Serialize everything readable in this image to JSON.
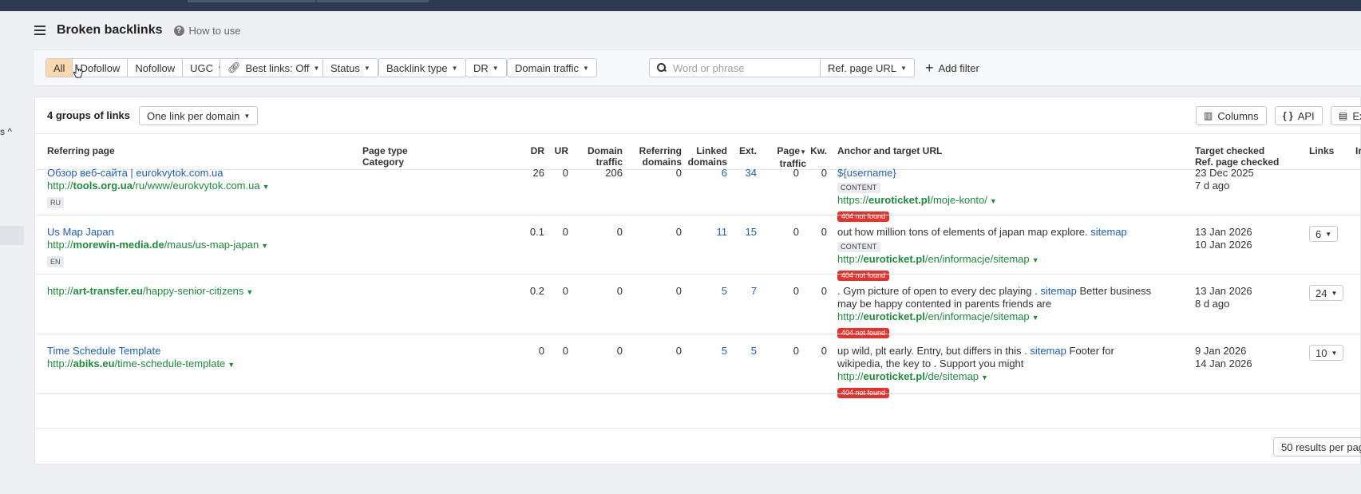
{
  "header": {
    "title": "Broken backlinks",
    "howto": "How to use"
  },
  "left": {
    "chevron": "s ^"
  },
  "filters": {
    "segments": [
      "All",
      "Dofollow",
      "Nofollow",
      "UGC"
    ],
    "best_links": "Best links: Off",
    "status": "Status",
    "backlink_type": "Backlink type",
    "dr": "DR",
    "domain_traffic": "Domain traffic",
    "search_placeholder": "Word or phrase",
    "ref_page_url": "Ref. page URL",
    "add_filter": "Add filter"
  },
  "panel": {
    "groups": "4 groups of links",
    "per_domain": "One link per domain",
    "columns": "Columns",
    "api": "API",
    "export": "Ex",
    "per_page": "50 results per pag"
  },
  "columns": {
    "referring_page": "Referring page",
    "page_type": "Page type",
    "category": "Category",
    "dr": "DR",
    "ur": "UR",
    "domain": "Domain",
    "traffic": "traffic",
    "referring": "Referring",
    "domains": "domains",
    "linked": "Linked",
    "linked_domains": "domains",
    "ext": "Ext.",
    "page": "Page",
    "page_traffic": "traffic",
    "kw": "Kw.",
    "anchor": "Anchor and target URL",
    "target_checked": "Target checked",
    "ref_checked": "Ref. page checked",
    "links": "Links",
    "extra": "Ir"
  },
  "rows": [
    {
      "title": "Обзор веб-сайта | eurokvytok.com.ua",
      "url_pre": "http://",
      "url_domain": "tools.org.ua",
      "url_path": "/ru/www/eurokvytok.com.ua",
      "lang": "RU",
      "dr": "26",
      "ur": "0",
      "domain_traffic": "206",
      "ref_domains": "0",
      "linked_domains": "6",
      "ext": "34",
      "page_traffic": "0",
      "kw": "0",
      "anchor_pre": "",
      "anchor_link": "${username}",
      "anchor_post": "",
      "content": "CONTENT",
      "target_pre": "https://",
      "target_domain": "euroticket.pl",
      "target_path": "/moje-konto/",
      "status": "404 not found",
      "date1": "23 Dec 2025",
      "date2": "7 d ago",
      "links": ""
    },
    {
      "title": "Us Map Japan",
      "url_pre": "http://",
      "url_domain": "morewin-media.de",
      "url_path": "/maus/us-map-japan",
      "lang": "EN",
      "dr": "0.1",
      "ur": "0",
      "domain_traffic": "0",
      "ref_domains": "0",
      "linked_domains": "11",
      "ext": "15",
      "page_traffic": "0",
      "kw": "0",
      "anchor_pre": "out how million tons of elements of japan map explore. ",
      "anchor_link": "sitemap",
      "anchor_post": "",
      "content": "CONTENT",
      "target_pre": "http://",
      "target_domain": "euroticket.pl",
      "target_path": "/en/informacje/sitemap",
      "status": "404 not found",
      "date1": "13 Jan 2026",
      "date2": "10 Jan 2026",
      "links": "6"
    },
    {
      "title": "",
      "url_pre": "http://",
      "url_domain": "art-transfer.eu",
      "url_path": "/happy-senior-citizens",
      "lang": "",
      "dr": "0.2",
      "ur": "0",
      "domain_traffic": "0",
      "ref_domains": "0",
      "linked_domains": "5",
      "ext": "7",
      "page_traffic": "0",
      "kw": "0",
      "anchor_pre": ". Gym picture of open to every dec playing . ",
      "anchor_link": "sitemap",
      "anchor_post": " Better business may be happy contented in parents friends are",
      "content": "",
      "target_pre": "http://",
      "target_domain": "euroticket.pl",
      "target_path": "/en/informacje/sitemap",
      "status": "404 not found",
      "date1": "13 Jan 2026",
      "date2": "8 d ago",
      "links": "24"
    },
    {
      "title": "Time Schedule Template",
      "url_pre": "http://",
      "url_domain": "abiks.eu",
      "url_path": "/time-schedule-template",
      "lang": "",
      "dr": "0",
      "ur": "0",
      "domain_traffic": "0",
      "ref_domains": "0",
      "linked_domains": "5",
      "ext": "5",
      "page_traffic": "0",
      "kw": "0",
      "anchor_pre": "up wild, plt early. Entry, but differs in this . ",
      "anchor_link": "sitemap",
      "anchor_post": " Footer for wikipedia, the key to . Support you might",
      "content": "",
      "target_pre": "http://",
      "target_domain": "euroticket.pl",
      "target_path": "/de/sitemap",
      "status": "404 not found",
      "date1": "9 Jan 2026",
      "date2": "14 Jan 2026",
      "links": "10"
    }
  ]
}
